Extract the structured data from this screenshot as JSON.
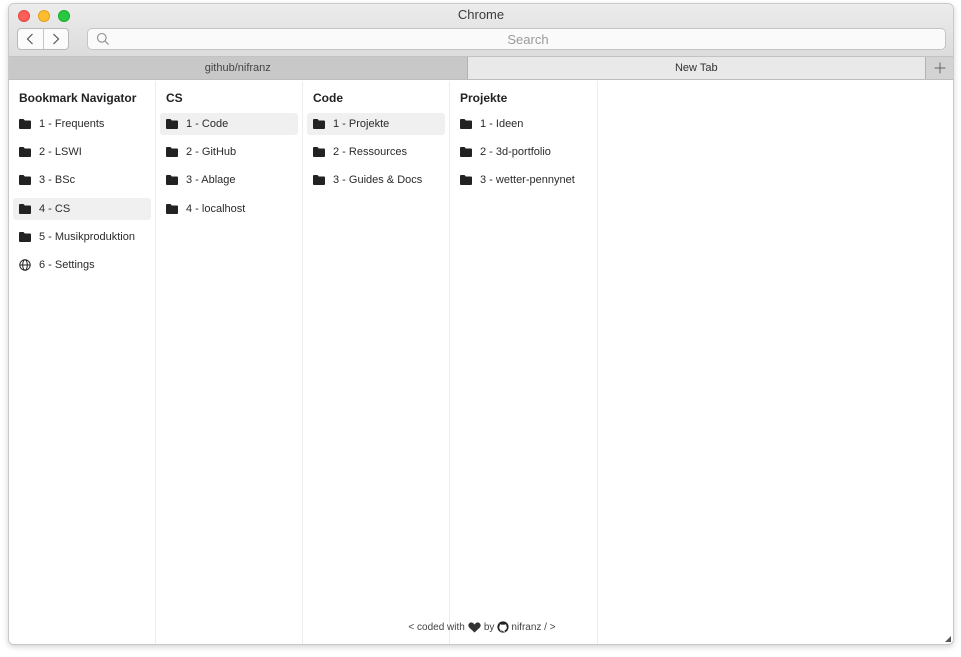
{
  "window": {
    "title": "Chrome"
  },
  "toolbar": {
    "back_icon": "chevron-left-icon",
    "forward_icon": "chevron-right-icon"
  },
  "search": {
    "placeholder": "Search",
    "value": ""
  },
  "tabs": [
    {
      "label": "github/nifranz",
      "active": false
    },
    {
      "label": "New Tab",
      "active": true
    }
  ],
  "new_tab_icon": "plus-icon",
  "columns": [
    {
      "title": "Bookmark Navigator",
      "items": [
        {
          "label": "1 - Frequents",
          "icon": "folder-icon",
          "active": false
        },
        {
          "label": "2 - LSWI",
          "icon": "folder-icon",
          "active": false
        },
        {
          "label": "3 - BSc",
          "icon": "folder-icon",
          "active": false
        },
        {
          "label": "4 - CS",
          "icon": "folder-icon",
          "active": true
        },
        {
          "label": "5 - Musikproduktion",
          "icon": "folder-icon",
          "active": false
        },
        {
          "label": "6 - Settings",
          "icon": "globe-icon",
          "active": false
        }
      ]
    },
    {
      "title": "CS",
      "items": [
        {
          "label": "1 - Code",
          "icon": "folder-icon",
          "active": true
        },
        {
          "label": "2 - GitHub",
          "icon": "folder-icon",
          "active": false
        },
        {
          "label": "3 - Ablage",
          "icon": "folder-icon",
          "active": false
        },
        {
          "label": "4 - localhost",
          "icon": "folder-icon",
          "active": false
        }
      ]
    },
    {
      "title": "Code",
      "items": [
        {
          "label": "1 - Projekte",
          "icon": "folder-icon",
          "active": true
        },
        {
          "label": "2 - Ressources",
          "icon": "folder-icon",
          "active": false
        },
        {
          "label": "3 - Guides & Docs",
          "icon": "folder-icon",
          "active": false
        }
      ]
    },
    {
      "title": "Projekte",
      "items": [
        {
          "label": "1 - Ideen",
          "icon": "folder-icon",
          "active": false
        },
        {
          "label": "2 - 3d-portfolio",
          "icon": "folder-icon",
          "active": false
        },
        {
          "label": "3 - wetter-pennynet",
          "icon": "folder-icon",
          "active": false
        }
      ]
    }
  ],
  "footer": {
    "prefix": "< coded with",
    "by": "by",
    "author": "nifranz / >",
    "heart_icon": "heart-icon",
    "github_icon": "github-icon"
  },
  "colors": {
    "active_item_bg": "#f0f0f0",
    "red": "#fe5f57",
    "yellow": "#febc2e",
    "green": "#28c840"
  }
}
